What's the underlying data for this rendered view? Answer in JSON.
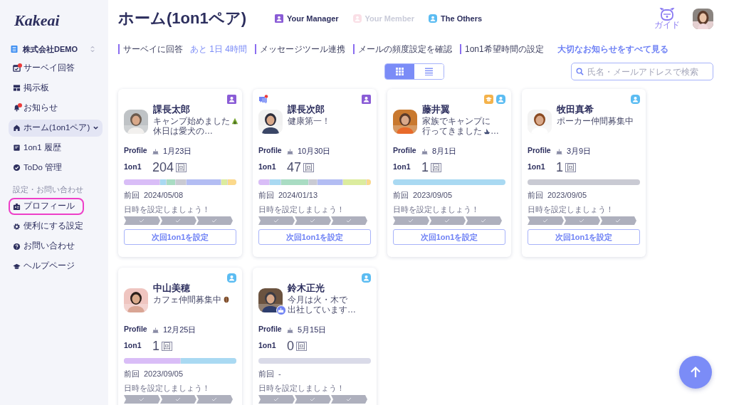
{
  "sidebar": {
    "logo": "Kakeai",
    "org": "株式会社DEMO",
    "items": [
      {
        "label": "サーベイ回答",
        "selected": false,
        "dot": true,
        "has_submenu": false
      },
      {
        "label": "掲示板",
        "selected": false,
        "dot": false,
        "has_submenu": false
      },
      {
        "label": "お知らせ",
        "selected": false,
        "dot": true,
        "has_submenu": false
      },
      {
        "label": "ホーム(1on1ペア)",
        "selected": true,
        "dot": false,
        "has_submenu": true
      },
      {
        "label": "1on1 履歴",
        "selected": false,
        "dot": false,
        "has_submenu": false
      },
      {
        "label": "ToDo 管理",
        "selected": false,
        "dot": false,
        "has_submenu": false
      }
    ],
    "section_heading": "設定・お問い合わせ",
    "settings_items": [
      {
        "label": "プロフィール",
        "highlighted": true
      },
      {
        "label": "便利にする設定",
        "highlighted": false
      },
      {
        "label": "お問い合わせ",
        "highlighted": false
      },
      {
        "label": "ヘルプページ",
        "highlighted": false
      }
    ]
  },
  "header": {
    "title": "ホーム(1on1ペア)",
    "legend": [
      {
        "label": "Your Manager",
        "kind": "manager",
        "dimmed": false
      },
      {
        "label": "Your Member",
        "kind": "member",
        "dimmed": true
      },
      {
        "label": "The Others",
        "kind": "other",
        "dimmed": false
      }
    ],
    "guide_label": "ガイド"
  },
  "notices": [
    {
      "label": "サーベイに回答",
      "accent": "あと 1日 4時間"
    },
    {
      "label": "メッセージツール連携"
    },
    {
      "label": "メールの頻度設定を確認"
    },
    {
      "label": "1on1希望時間の設定"
    }
  ],
  "notices_link": "大切なお知らせをすべて見る",
  "view_toggle": [
    {
      "kind": "grid",
      "selected": true
    },
    {
      "kind": "list",
      "selected": false
    }
  ],
  "search": {
    "placeholder": "氏名・メールアドレスで検索"
  },
  "cards": [
    {
      "name": "課長太郎",
      "has_message": false,
      "birthday_badge": false,
      "roles": [
        {
          "kind": "manager"
        }
      ],
      "status": [
        {
          "text": "キャンプ始めました",
          "emoji": true
        },
        {
          "text": "休日は愛犬の…",
          "emoji": false
        }
      ],
      "profile_label": "Profile",
      "birthday": "1月23日",
      "count_label": "1on1",
      "count": "204",
      "unit": "回",
      "segments": [
        {
          "color": "#d9bdf7"
        },
        {
          "color": "#a9d9f2"
        },
        {
          "color": "#a9dcc3"
        },
        {
          "color": "#c9cad3"
        },
        {
          "color": "#b3bdf3"
        },
        {
          "color": "#dcec9e"
        },
        {
          "color": "#fcd98b"
        }
      ],
      "last_label": "前回",
      "last": "2024/05/08",
      "hint": "日時を設定しましょう！",
      "button": "次回1on1を設定"
    },
    {
      "name": "課長次郎",
      "has_message": true,
      "birthday_badge": false,
      "roles": [
        {
          "kind": "manager"
        }
      ],
      "status": [
        {
          "text": "健康第一！",
          "emoji": false
        }
      ],
      "profile_label": "Profile",
      "birthday": "10月30日",
      "count_label": "1on1",
      "count": "47",
      "unit": "回",
      "segments": [
        {
          "color": "#d9bdf7"
        },
        {
          "color": "#a9d9f2"
        },
        {
          "color": "#a9dcc3"
        },
        {
          "color": "#c9cad3"
        },
        {
          "color": "#b3bdf3"
        },
        {
          "color": "#dcec9e"
        },
        {
          "color": "#fcd98b"
        }
      ],
      "last_label": "前回",
      "last": "2024/01/13",
      "hint": "日時を設定しましょう！",
      "button": "次回1on1を設定"
    },
    {
      "name": "藤井翼",
      "has_message": false,
      "birthday_badge": false,
      "roles": [
        {
          "kind": "mentor"
        },
        {
          "kind": "other"
        }
      ],
      "status": [
        {
          "text": "家族でキャンプに",
          "emoji": false
        },
        {
          "text": "行ってきました",
          "emoji": true,
          "tail": "…"
        }
      ],
      "profile_label": "Profile",
      "birthday": "8月1日",
      "count_label": "1on1",
      "count": "1",
      "unit": "回",
      "segments": [
        {
          "color": "#a9d9f2"
        }
      ],
      "last_label": "前回",
      "last": "2023/09/05",
      "hint": "日時を設定しましょう！",
      "button": "次回1on1を設定"
    },
    {
      "name": "牧田真希",
      "has_message": false,
      "birthday_badge": false,
      "roles": [
        {
          "kind": "other"
        }
      ],
      "status": [
        {
          "text": "ポーカー仲間募集中",
          "emoji": false
        }
      ],
      "profile_label": "Profile",
      "birthday": "3月9日",
      "count_label": "1on1",
      "count": "1",
      "unit": "回",
      "segments": [
        {
          "color": "#c9cad3"
        }
      ],
      "last_label": "前回",
      "last": "2023/09/05",
      "hint": "日時を設定しましょう！",
      "button": "次回1on1を設定"
    },
    {
      "name": "中山美穂",
      "has_message": false,
      "birthday_badge": false,
      "roles": [
        {
          "kind": "other"
        }
      ],
      "status": [
        {
          "text": "カフェ仲間募集中",
          "emoji": true
        }
      ],
      "profile_label": "Profile",
      "birthday": "12月25日",
      "count_label": "1on1",
      "count": "1",
      "unit": "回",
      "segments": [
        {
          "color": "#d9bdf7"
        },
        {
          "color": "#a9d9f2"
        }
      ],
      "last_label": "前回",
      "last": "2023/09/05",
      "hint": "日時を設定しましょう！"
    },
    {
      "name": "鈴木正光",
      "has_message": false,
      "birthday_badge": true,
      "roles": [
        {
          "kind": "other"
        }
      ],
      "status": [
        {
          "text": "今月は火・木で",
          "emoji": false
        },
        {
          "text": "出社しています…",
          "emoji": false
        }
      ],
      "profile_label": "Profile",
      "birthday": "5月15日",
      "count_label": "1on1",
      "count": "0",
      "unit": "回",
      "last_label": "前回",
      "last": "-",
      "hint": "日時を設定しましょう！"
    }
  ]
}
